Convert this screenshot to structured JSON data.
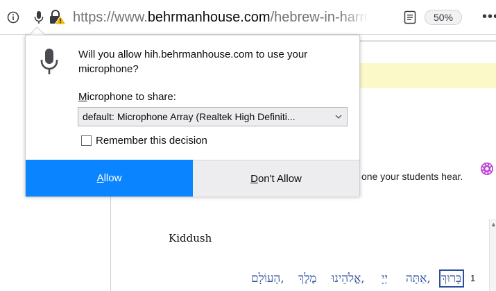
{
  "urlbar": {
    "url_prefix": "https://www.",
    "url_host": "behrmanhouse.com",
    "url_path": "/hebrew-in-harmo",
    "zoom": "50%",
    "more": "•••"
  },
  "popup": {
    "message": "Will you allow hih.behrmanhouse.com to use your microphone?",
    "share_label_key": "M",
    "share_label_rest": "icrophone to share:",
    "selected_device": "default: Microphone Array (Realtek High Definiti...",
    "remember_label": "Remember this decision",
    "remember_checked": false,
    "allow_label": "Allow",
    "deny_label": "Don't Allow"
  },
  "page": {
    "students_text": "one your students hear.",
    "section_title": "Kiddush",
    "hebrew_words": [
      "בָּרוּךְ",
      "אַתָּה,",
      "יְיָ",
      "אֱלֹהֵינוּ,",
      "מֶלֶךְ",
      "הָעוֹלָם,"
    ],
    "line_number": "1"
  },
  "colors": {
    "allow_button": "#0a84ff",
    "deny_button": "#ededf0",
    "hebrew_text": "#2b4f9e",
    "yellow_band": "#fcf9c9",
    "warning": "#f2b600"
  },
  "icons": [
    "info-icon",
    "microphone-icon",
    "lock-warning-icon",
    "reader-view-icon",
    "more-icon",
    "gear-icon",
    "chevron-down-icon"
  ]
}
